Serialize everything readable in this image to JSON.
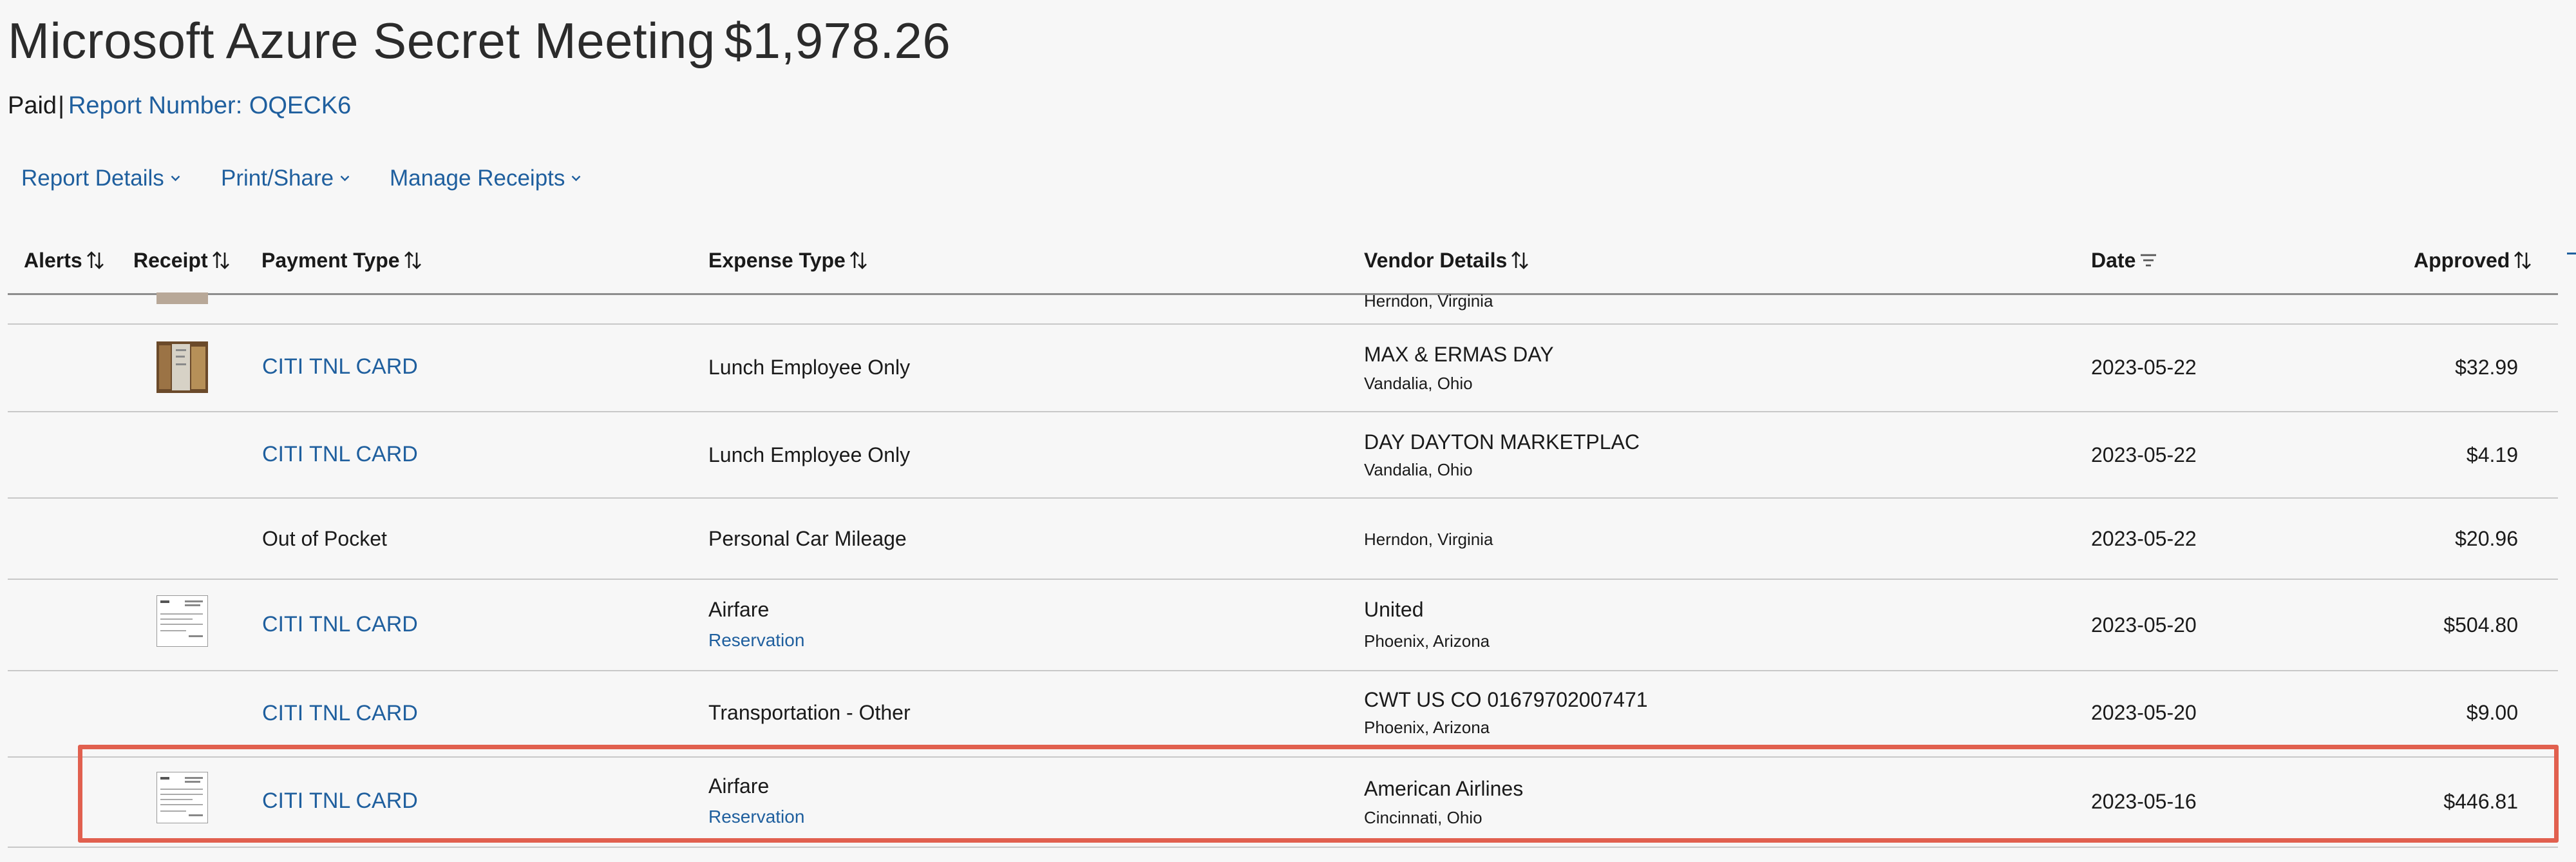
{
  "report": {
    "title": "Microsoft Azure Secret Meeting",
    "amount": "$1,978.26",
    "status": "Paid",
    "separator": "|",
    "report_number": "Report Number: OQECK6"
  },
  "menu": {
    "items": [
      {
        "label": "Report Details"
      },
      {
        "label": "Print/Share"
      },
      {
        "label": "Manage Receipts"
      }
    ]
  },
  "table": {
    "headers": {
      "alerts": "Alerts",
      "receipt": "Receipt",
      "payment_type": "Payment Type",
      "expense_type": "Expense Type",
      "vendor_details": "Vendor Details",
      "date": "Date",
      "approved": "Approved"
    },
    "partial_row": {
      "vendor_location": "Herndon, Virginia"
    },
    "rows": [
      {
        "receipt": "photo",
        "payment_type": "CITI TNL CARD",
        "payment_is_link": true,
        "expense_type": "Lunch Employee Only",
        "expense_sub": "",
        "vendor": "MAX & ERMAS DAY",
        "location": "Vandalia, Ohio",
        "date": "2023-05-22",
        "approved": "$32.99"
      },
      {
        "receipt": "",
        "payment_type": "CITI TNL CARD",
        "payment_is_link": true,
        "expense_type": "Lunch Employee Only",
        "expense_sub": "",
        "vendor": "DAY DAYTON MARKETPLAC",
        "location": "Vandalia, Ohio",
        "date": "2023-05-22",
        "approved": "$4.19"
      },
      {
        "receipt": "",
        "payment_type": "Out of Pocket",
        "payment_is_link": false,
        "expense_type": "Personal Car Mileage",
        "expense_sub": "",
        "vendor": "",
        "location": "Herndon, Virginia",
        "date": "2023-05-22",
        "approved": "$20.96"
      },
      {
        "receipt": "document",
        "payment_type": "CITI TNL CARD",
        "payment_is_link": true,
        "expense_type": "Airfare",
        "expense_sub": "Reservation",
        "vendor": "United",
        "location": "Phoenix, Arizona",
        "date": "2023-05-20",
        "approved": "$504.80"
      },
      {
        "receipt": "",
        "payment_type": "CITI TNL CARD",
        "payment_is_link": true,
        "expense_type": "Transportation - Other",
        "expense_sub": "",
        "vendor": "CWT US CO 01679702007471",
        "location": "Phoenix, Arizona",
        "date": "2023-05-20",
        "approved": "$9.00"
      },
      {
        "receipt": "document",
        "payment_type": "CITI TNL CARD",
        "payment_is_link": true,
        "expense_type": "Airfare",
        "expense_sub": "Reservation",
        "vendor": "American Airlines",
        "location": "Cincinnati, Ohio",
        "date": "2023-05-16",
        "approved": "$446.81",
        "highlighted": true
      }
    ]
  },
  "colors": {
    "link": "#1f5f9e",
    "highlight": "#e1604f",
    "background": "#f7f7f7"
  }
}
